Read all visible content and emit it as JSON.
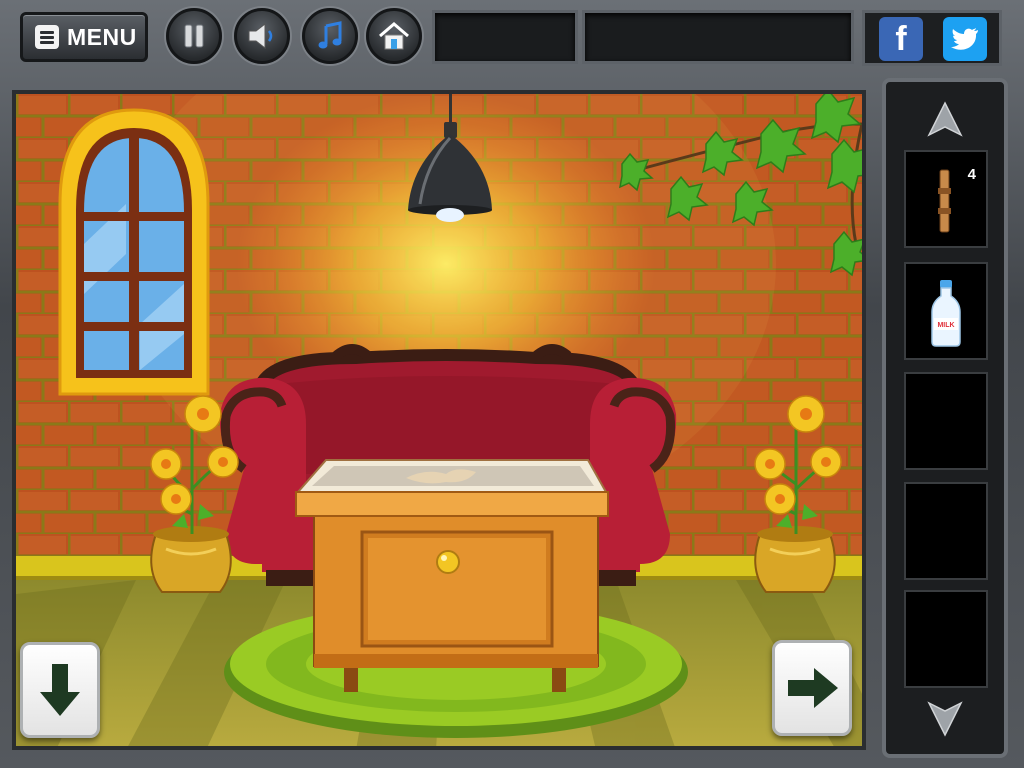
{
  "header": {
    "menu_label": "MENU",
    "buttons": [
      {
        "id": "pause",
        "icon": "pause-icon"
      },
      {
        "id": "sound",
        "icon": "speaker-icon"
      },
      {
        "id": "music",
        "icon": "music-note-icon"
      },
      {
        "id": "home",
        "icon": "home-icon"
      }
    ]
  },
  "social": {
    "facebook_letter": "f",
    "icons": [
      "facebook-icon",
      "twitter-icon"
    ]
  },
  "inventory": {
    "slots": [
      {
        "item": "wooden-stick",
        "count": "4"
      },
      {
        "item": "milk-bottle",
        "label": "MILK"
      },
      {
        "item": ""
      },
      {
        "item": ""
      },
      {
        "item": ""
      }
    ]
  },
  "navigation": {
    "down_icon": "arrow-down-icon",
    "right_icon": "arrow-right-icon"
  },
  "colors": {
    "wall": "#c95a26",
    "brick_lines": "#8f7a1c",
    "sofa": "#b01f34",
    "floor": "#a9a03b",
    "rug": "#8fbf21",
    "cabinet": "#dd8a2a",
    "facebook": "#3a67b5",
    "twitter": "#1da1f2"
  }
}
